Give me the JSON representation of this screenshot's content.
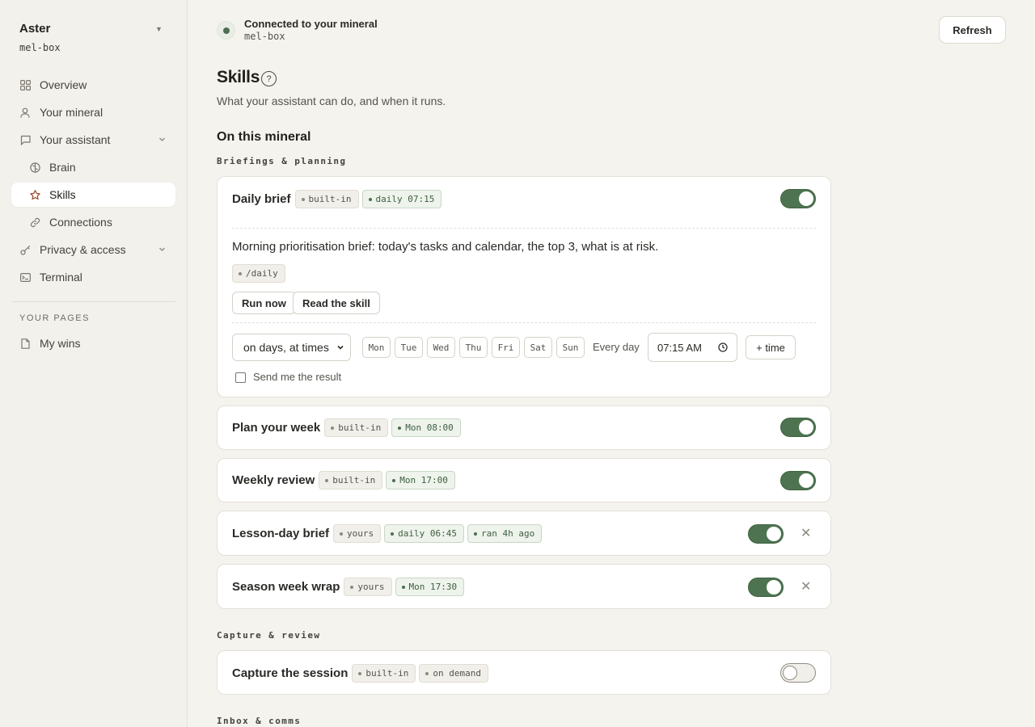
{
  "sidebar": {
    "brand": "Aster",
    "host": "mel-box",
    "items": [
      {
        "label": "Overview"
      },
      {
        "label": "Your mineral"
      },
      {
        "label": "Your assistant"
      },
      {
        "label": "Brain"
      },
      {
        "label": "Skills"
      },
      {
        "label": "Connections"
      },
      {
        "label": "Privacy & access"
      },
      {
        "label": "Terminal"
      }
    ],
    "pages_heading": "YOUR PAGES",
    "pages": [
      {
        "label": "My wins"
      }
    ]
  },
  "status": {
    "title": "Connected to your mineral",
    "host": "mel-box",
    "refresh_label": "Refresh"
  },
  "page": {
    "title": "Skills",
    "help": "?",
    "subtitle": "What your assistant can do, and when it runs.",
    "section": "On this mineral"
  },
  "groups": [
    {
      "title": "Briefings & planning"
    },
    {
      "title": "Capture & review"
    },
    {
      "title": "Inbox & comms"
    }
  ],
  "daily_brief": {
    "name": "Daily brief",
    "tags": [
      "built-in",
      "daily 07:15"
    ],
    "enabled": true,
    "description": "Morning prioritisation brief: today's tasks and calendar, the top 3, what is at risk.",
    "command": "/daily",
    "run_now": "Run now",
    "read_skill": "Read the skill",
    "schedule_mode": "on days, at times",
    "days": [
      "Mon",
      "Tue",
      "Wed",
      "Thu",
      "Fri",
      "Sat",
      "Sun"
    ],
    "every_day": "Every day",
    "time": "07:15 AM",
    "add_time": "+ time",
    "send_result": "Send me the result"
  },
  "skills": [
    {
      "name": "Plan your week",
      "tags": [
        "built-in",
        "Mon 08:00"
      ],
      "enabled": true
    },
    {
      "name": "Weekly review",
      "tags": [
        "built-in",
        "Mon 17:00"
      ],
      "enabled": true
    },
    {
      "name": "Lesson-day brief",
      "tags": [
        "yours",
        "daily 06:45",
        "ran 4h ago"
      ],
      "enabled": true
    },
    {
      "name": "Season week wrap",
      "tags": [
        "yours",
        "Mon 17:30"
      ],
      "enabled": true
    },
    {
      "name": "Capture the session",
      "tags": [
        "built-in",
        "on demand"
      ],
      "enabled": false
    }
  ],
  "colors": {
    "accent_green": "#4d7351",
    "active_icon": "#9a4a2a",
    "background": "#f5f3ee"
  }
}
